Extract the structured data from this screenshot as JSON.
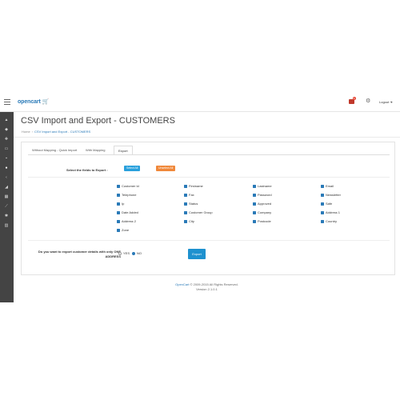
{
  "header": {
    "logo": "opencart",
    "logo_cart": "🛒",
    "alert_count": "1",
    "logout": "Logout"
  },
  "sidebar": {
    "icons": [
      "dashboard-icon",
      "tag-icon",
      "puzzle-icon",
      "desktop-icon",
      "cart-icon",
      "user-icon",
      "share-icon",
      "rss-icon",
      "calendar-icon",
      "chart-icon",
      "cog-icon",
      "bar-chart-icon"
    ]
  },
  "page": {
    "title": "CSV Import and Export - CUSTOMERS",
    "breadcrumb": [
      "Home",
      "CSV Import and Export - CUSTOMERS"
    ]
  },
  "tabs": [
    "Without Mapping - Quick Import",
    "With Mapping",
    "Export"
  ],
  "export": {
    "select_label": "Select the fields to Export :",
    "select_all": "Select All",
    "unselect_all": "Unselect All",
    "fields": [
      [
        "Customer Id",
        "Firstname",
        "Lastname",
        "Email"
      ],
      [
        "Telephone",
        "Fax",
        "Password",
        "Newsletter"
      ],
      [
        "Ip",
        "Status",
        "Approved",
        "Safe"
      ],
      [
        "Date Added",
        "Customer Group",
        "Company",
        "Address 1"
      ],
      [
        "Address 2",
        "City",
        "Postcode",
        "Country"
      ],
      [
        "Zone"
      ]
    ],
    "question": "Do you want to export customer details with only ONE ADDRESS",
    "radio_yes": "YES",
    "radio_no": "NO",
    "export_button": "Export"
  },
  "footer": {
    "brand": "OpenCart",
    "copyright": " © 2009-2015 All Rights Reserved.",
    "version": "Version 2.1.0.1"
  }
}
